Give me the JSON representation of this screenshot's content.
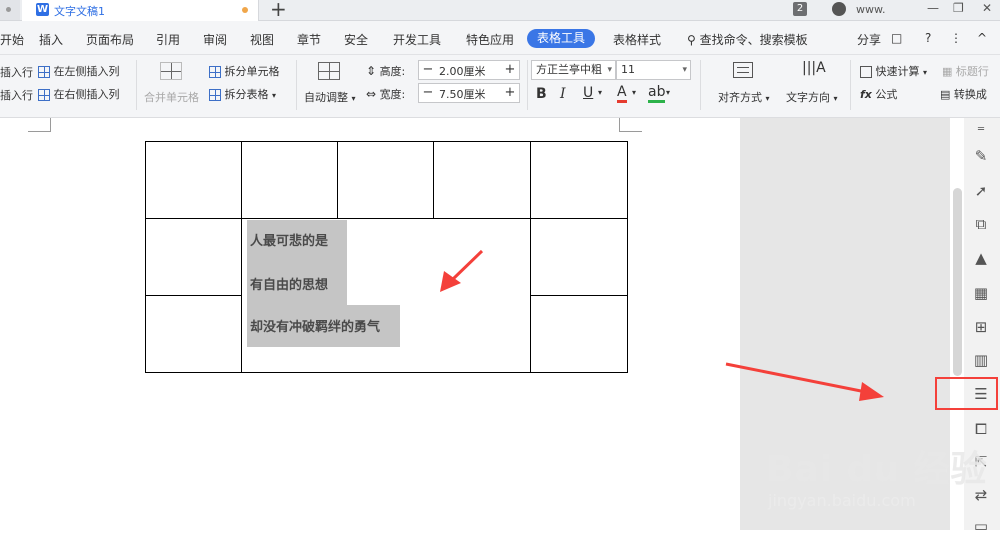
{
  "titlebar": {
    "doc_title": "文字文稿1",
    "badge": "2",
    "user": "www.",
    "win_minimize": "—",
    "win_restore": "❐",
    "win_close": "✕"
  },
  "menu": {
    "items": [
      "开始",
      "插入",
      "页面布局",
      "引用",
      "审阅",
      "视图",
      "章节",
      "安全",
      "开发工具",
      "特色应用"
    ],
    "active": "表格工具",
    "after": "表格样式",
    "search": "查找命令、搜索模板",
    "share": "分享",
    "help": "?",
    "more": "⋮",
    "collapse": "^"
  },
  "ribbon": {
    "insert_row_above": "插入行",
    "insert_row_below": "插入行",
    "insert_col_left": "在左侧插入列",
    "insert_col_right": "在右侧插入列",
    "merge_cells": "合并单元格",
    "split_cells": "拆分单元格",
    "split_table": "拆分表格",
    "auto_fit": "自动调整",
    "height_label": "高度:",
    "height_value": "2.00厘米",
    "width_label": "宽度:",
    "width_value": "7.50厘米",
    "font_name": "方正兰亭中粗",
    "font_size": "11",
    "bold": "B",
    "italic": "I",
    "underline": "U",
    "font_color": "A",
    "highlight": "ab",
    "align": "对齐方式",
    "text_dir": "文字方向",
    "quick_calc": "快速计算",
    "title_row": "标题行",
    "formula": "公式",
    "convert": "转换成"
  },
  "document": {
    "lines": [
      "人最可悲的是",
      "有自由的思想",
      "却没有冲破羁绊的勇气"
    ]
  },
  "watermark": {
    "brand": "Bai du 经验",
    "url": "jingyan.baidu.com"
  },
  "colors": {
    "accent": "#3a76e6",
    "annotation_red": "#f4403a",
    "selection_gray": "#c5c5c5"
  }
}
